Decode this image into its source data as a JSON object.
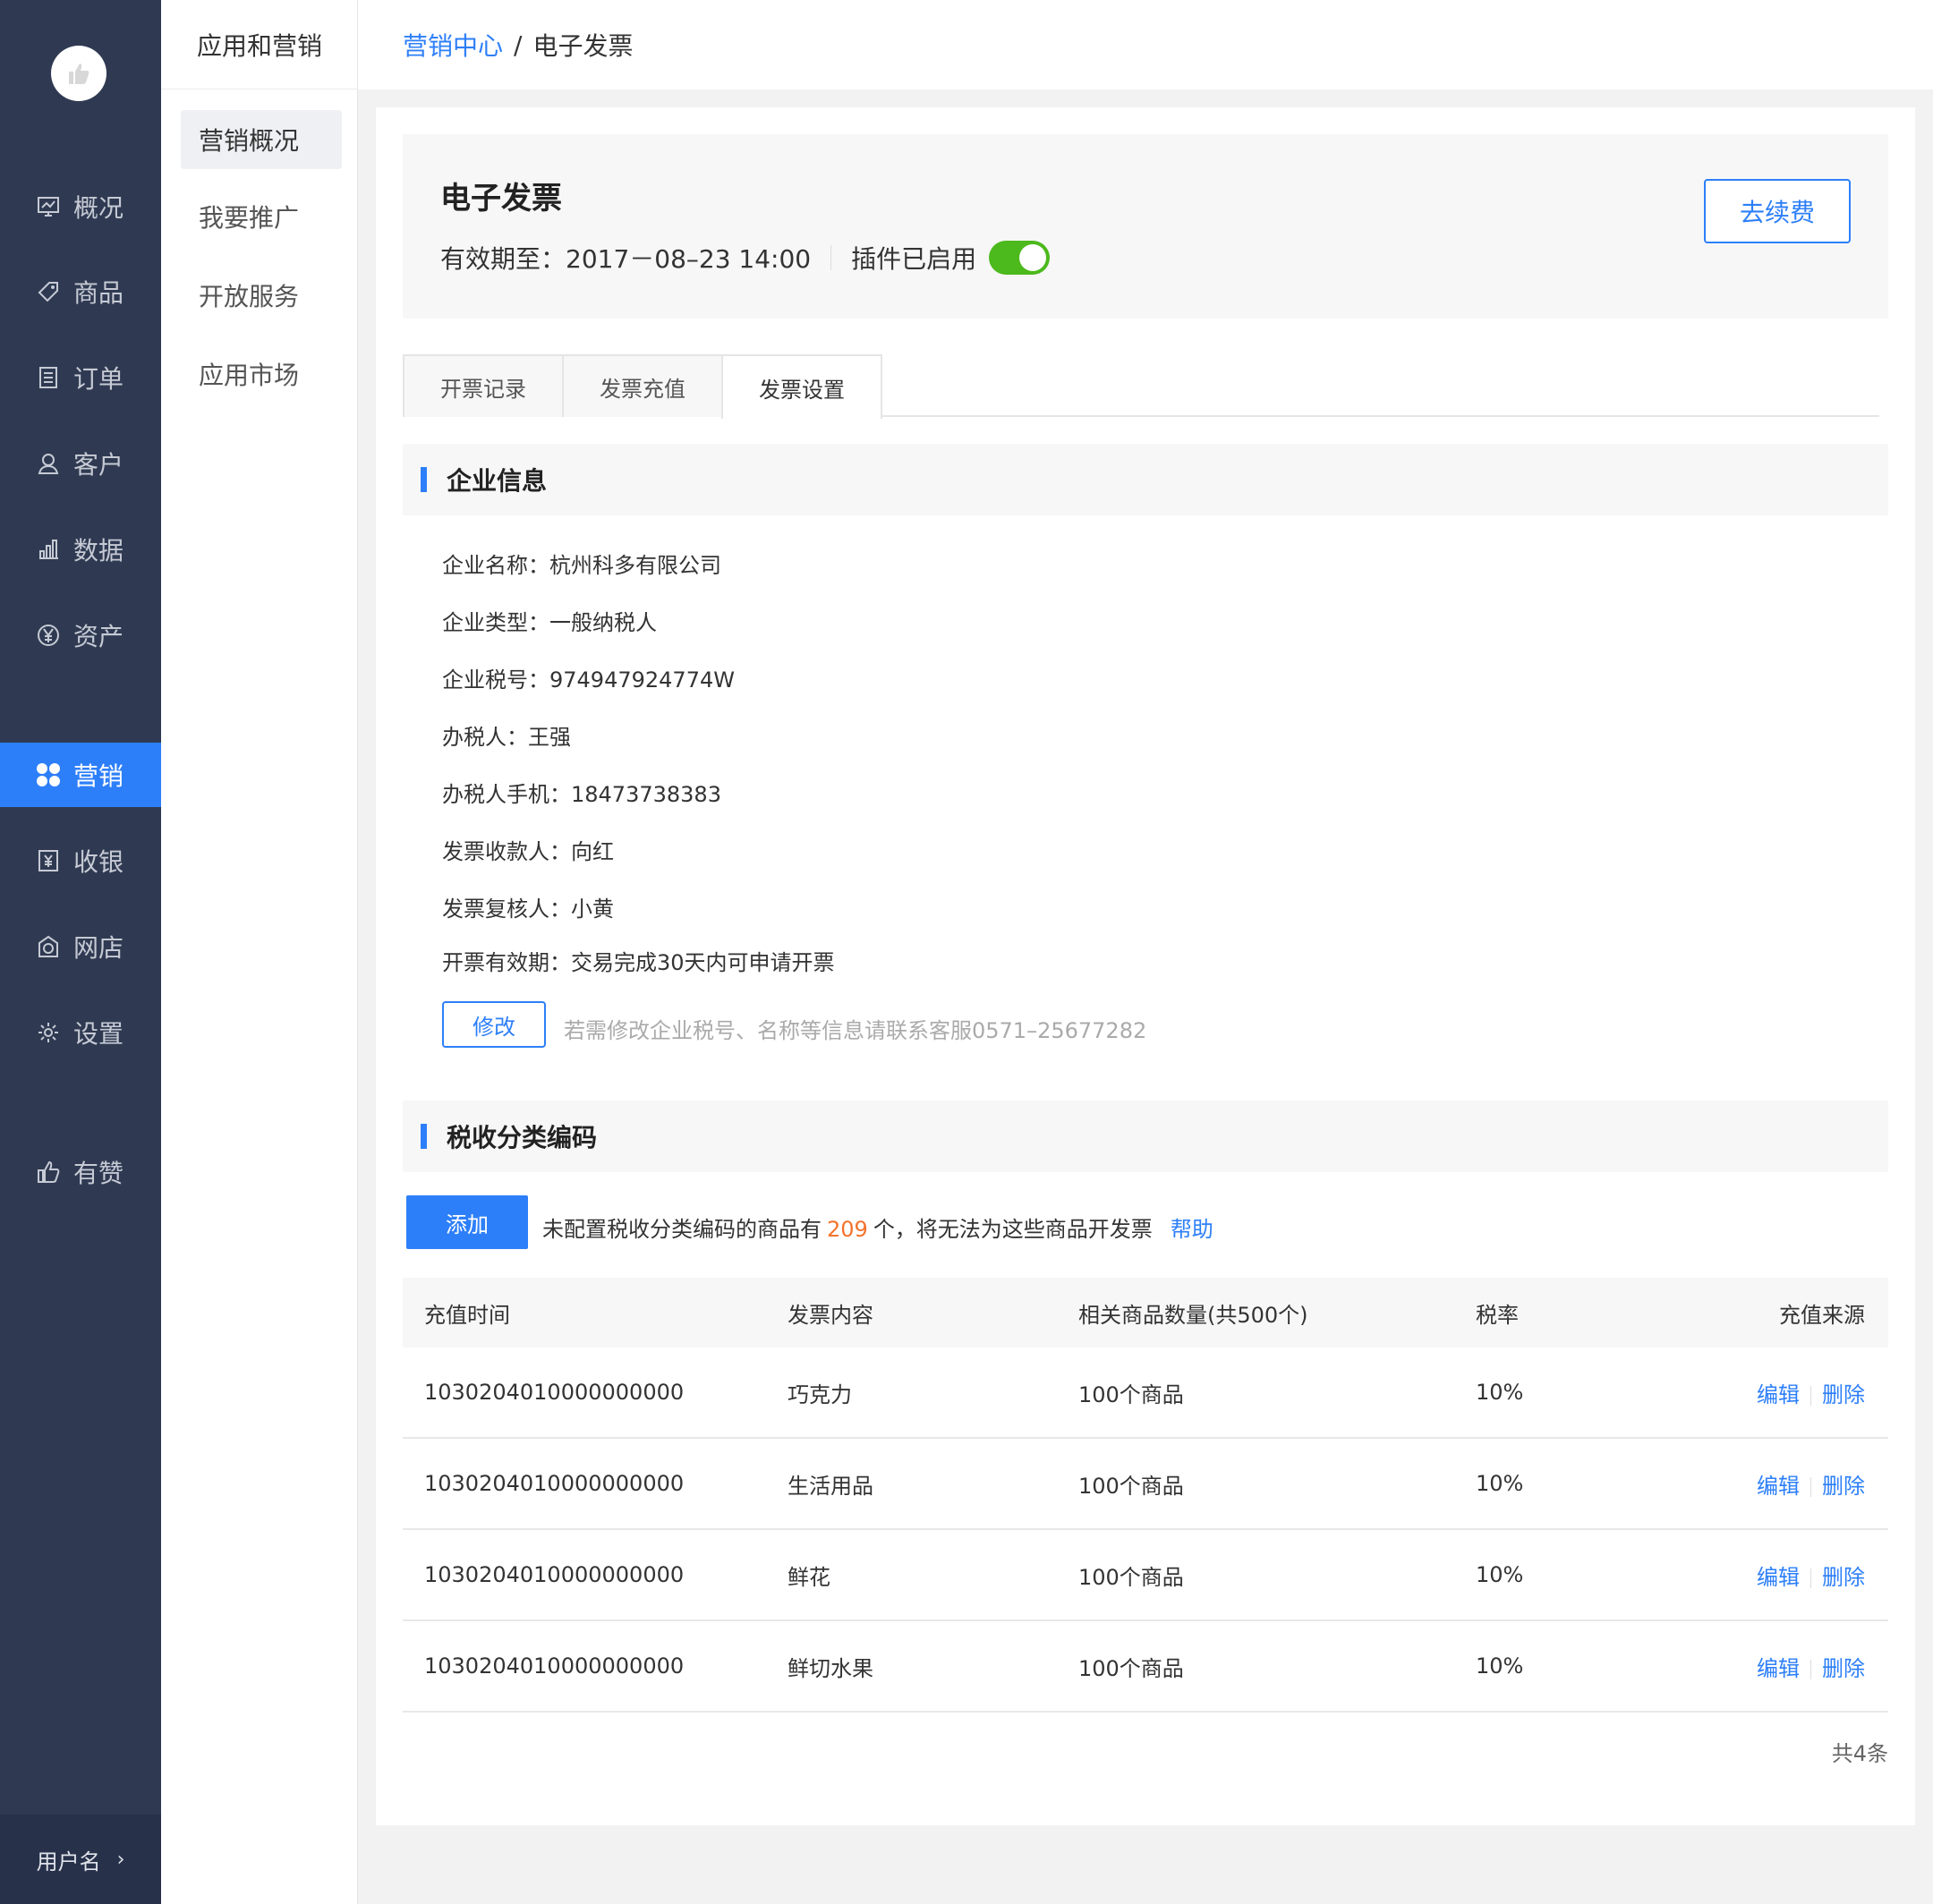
{
  "sidebar": {
    "items": [
      {
        "label": "概况",
        "icon": "overview-icon"
      },
      {
        "label": "商品",
        "icon": "tag-icon"
      },
      {
        "label": "订单",
        "icon": "order-icon"
      },
      {
        "label": "客户",
        "icon": "customer-icon"
      },
      {
        "label": "数据",
        "icon": "chart-icon"
      },
      {
        "label": "资产",
        "icon": "yen-icon"
      },
      {
        "label": "营销",
        "icon": "marketing-icon",
        "active": true
      },
      {
        "label": "收银",
        "icon": "cashier-icon"
      },
      {
        "label": "网店",
        "icon": "shop-icon"
      },
      {
        "label": "设置",
        "icon": "gear-icon"
      },
      {
        "label": "有赞",
        "icon": "thumb-up-icon"
      }
    ],
    "user": "用户名",
    "user_chevron": "›"
  },
  "subnav": {
    "title": "应用和营销",
    "items": [
      "营销概况",
      "我要推广",
      "开放服务",
      "应用市场"
    ]
  },
  "breadcrumb": {
    "parent": "营销中心",
    "sep": "/",
    "current": "电子发票"
  },
  "header": {
    "title": "电子发票",
    "validity": "有效期至：2017－08–23 14:00",
    "plugin_status": "插件已启用",
    "plugin_enabled": true,
    "renew_label": "去续费"
  },
  "tabs": [
    "开票记录",
    "发票充值",
    "发票设置"
  ],
  "active_tab": "发票设置",
  "company": {
    "section_title": "企业信息",
    "rows": [
      "企业名称：杭州科多有限公司",
      "企业类型：一般纳税人",
      "企业税号：974947924774W",
      "办税人：王强",
      "办税人手机：18473738383",
      "发票收款人：向红",
      "发票复核人：小黄",
      "开票有效期：交易完成30天内可申请开票"
    ],
    "edit_label": "修改",
    "edit_hint": "若需修改企业税号、名称等信息请联系客服0571–25677282"
  },
  "tax": {
    "section_title": "税收分类编码",
    "add_label": "添加",
    "note_prefix": "未配置税收分类编码的商品有",
    "note_count": "209",
    "note_suffix": "个，将无法为这些商品开发票",
    "help_label": "帮助",
    "columns": [
      "充值时间",
      "发票内容",
      "相关商品数量(共500个)",
      "税率",
      "充值来源"
    ],
    "rows": [
      {
        "code": "1030204010000000000",
        "content": "巧克力",
        "qty": "100个商品",
        "rate": "10%"
      },
      {
        "code": "1030204010000000000",
        "content": "生活用品",
        "qty": "100个商品",
        "rate": "10%"
      },
      {
        "code": "1030204010000000000",
        "content": "鲜花",
        "qty": "100个商品",
        "rate": "10%"
      },
      {
        "code": "1030204010000000000",
        "content": "鲜切水果",
        "qty": "100个商品",
        "rate": "10%"
      }
    ],
    "edit_op": "编辑",
    "delete_op": "删除",
    "total": "共4条"
  },
  "colors": {
    "accent": "#2d7ff9",
    "sidebar": "#2f3a52",
    "toggle_on": "#4cb91c",
    "highlight": "#f4722b"
  }
}
